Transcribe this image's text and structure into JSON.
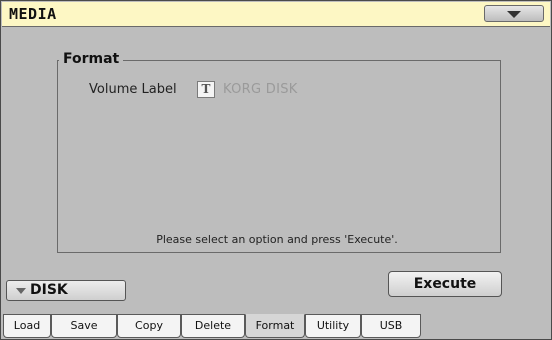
{
  "header": {
    "title": "MEDIA"
  },
  "format_panel": {
    "legend": "Format",
    "volume_label": "Volume Label",
    "text_edit_glyph": "T",
    "volume_value": "KORG DISK",
    "status_message": "Please select an option and press 'Execute'."
  },
  "device_selector": {
    "label": "DISK"
  },
  "actions": {
    "execute_label": "Execute"
  },
  "tabs": [
    {
      "label": "Load"
    },
    {
      "label": "Save"
    },
    {
      "label": "Copy"
    },
    {
      "label": "Delete"
    },
    {
      "label": "Format",
      "active": true
    },
    {
      "label": "Utility"
    },
    {
      "label": "USB"
    }
  ],
  "colors": {
    "title_bar": "#fdf7c4",
    "panel": "#bdbdbd",
    "disabled_text": "#9a9a9a"
  }
}
